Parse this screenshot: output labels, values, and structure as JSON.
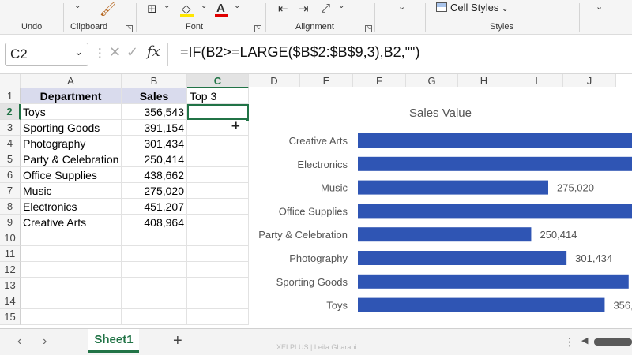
{
  "ribbon": {
    "groups": [
      {
        "label": "Undo"
      },
      {
        "label": "Clipboard"
      },
      {
        "label": "Font"
      },
      {
        "label": "Alignment"
      },
      {
        "label": "Styles"
      }
    ],
    "cell_styles_label": "Cell Styles",
    "colors": {
      "highlight": "#ffe600",
      "font_color": "#e00000"
    }
  },
  "formula_bar": {
    "name_box": "C2",
    "fx_label": "fx",
    "formula": "=IF(B2>=LARGE($B$2:$B$9,3),B2,\"\")"
  },
  "columns": [
    "A",
    "B",
    "C",
    "D",
    "E",
    "F",
    "G",
    "H",
    "I",
    "J"
  ],
  "rows": [
    "1",
    "2",
    "3",
    "4",
    "5",
    "6",
    "7",
    "8",
    "9",
    "10",
    "11",
    "12",
    "13",
    "14",
    "15"
  ],
  "table": {
    "headers": [
      "Department",
      "Sales",
      "Top 3"
    ],
    "rows": [
      {
        "department": "Toys",
        "sales": "356,543",
        "top3": ""
      },
      {
        "department": "Sporting Goods",
        "sales": "391,154",
        "top3": ""
      },
      {
        "department": "Photography",
        "sales": "301,434",
        "top3": ""
      },
      {
        "department": "Party & Celebration",
        "sales": "250,414",
        "top3": ""
      },
      {
        "department": "Office Supplies",
        "sales": "438,662",
        "top3": ""
      },
      {
        "department": "Music",
        "sales": "275,020",
        "top3": ""
      },
      {
        "department": "Electronics",
        "sales": "451,207",
        "top3": ""
      },
      {
        "department": "Creative Arts",
        "sales": "408,964",
        "top3": ""
      }
    ]
  },
  "chart_data": {
    "type": "bar",
    "orientation": "horizontal",
    "title": "Sales Value",
    "categories": [
      "Creative Arts",
      "Electronics",
      "Music",
      "Office Supplies",
      "Party & Celebration",
      "Photography",
      "Sporting Goods",
      "Toys"
    ],
    "values": [
      408964,
      451207,
      275020,
      438662,
      250414,
      301434,
      391154,
      356543
    ],
    "data_labels": [
      "",
      "",
      "275,020",
      "",
      "250,414",
      "301,434",
      "",
      "356,"
    ],
    "bar_color": "#2f55b4",
    "grid": false
  },
  "sheet_tabs": {
    "active": "Sheet1",
    "watermark": "XELPLUS | Leila Gharani"
  }
}
